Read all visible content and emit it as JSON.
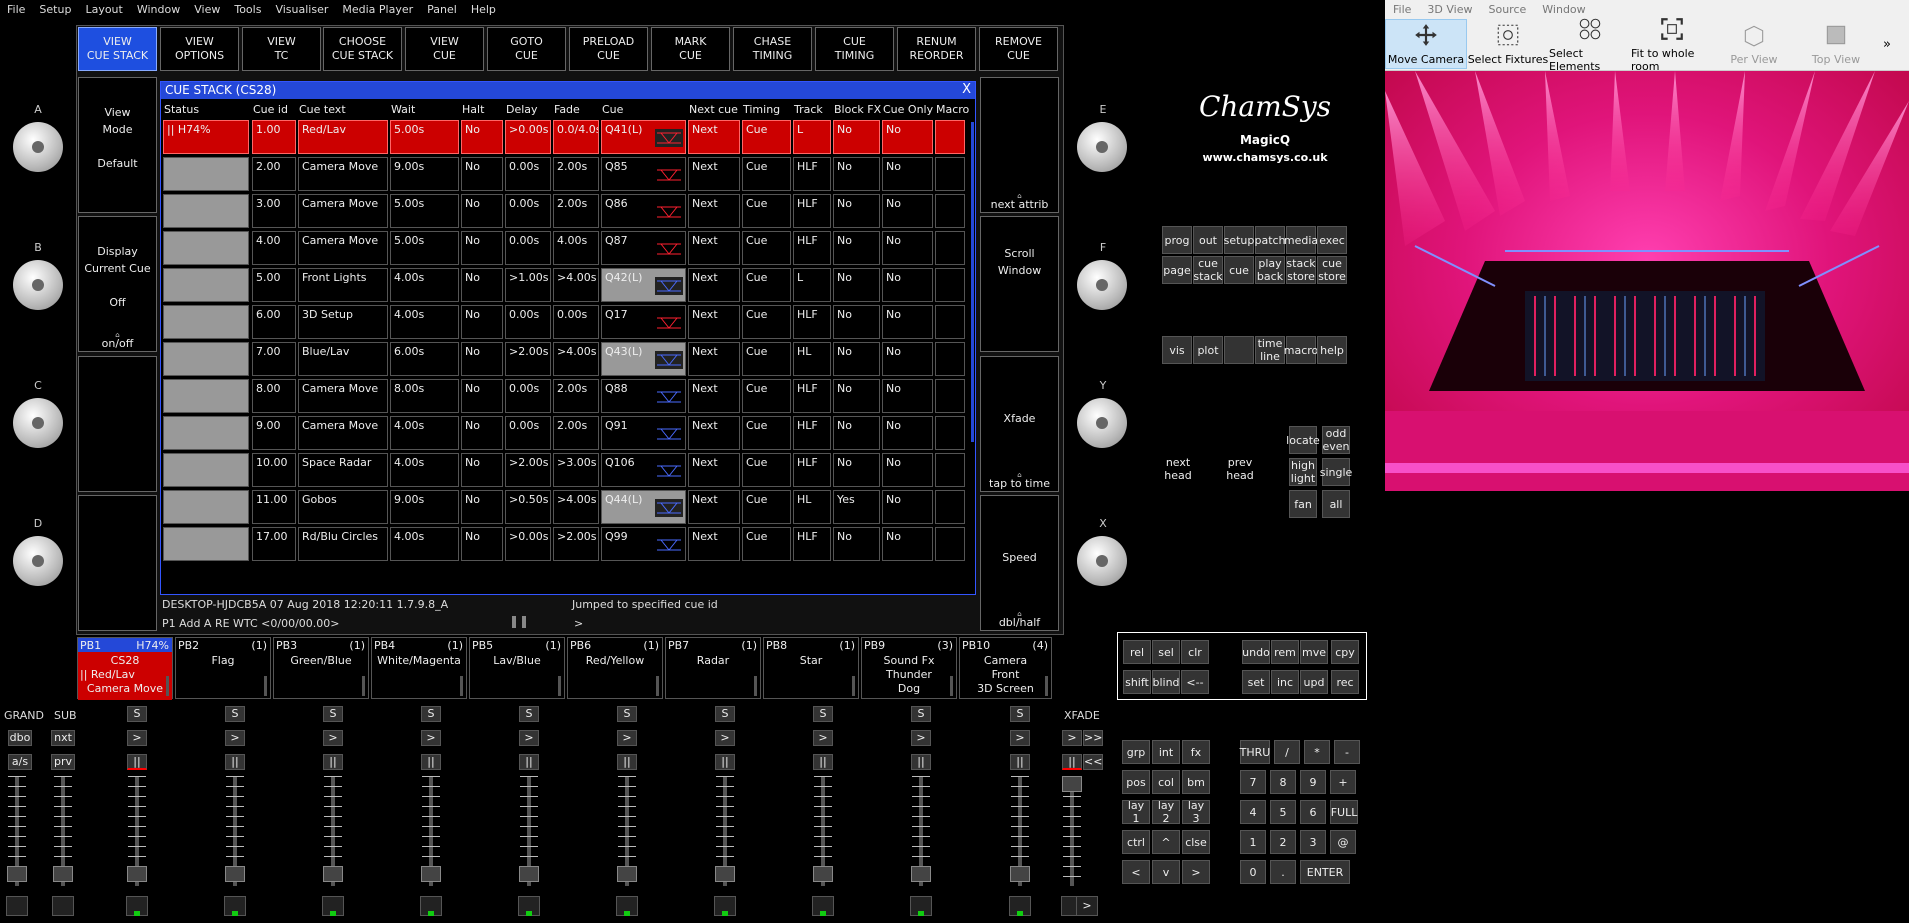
{
  "menubar": [
    "File",
    "Setup",
    "Layout",
    "Window",
    "View",
    "Tools",
    "Visualiser",
    "Media Player",
    "Panel",
    "Help"
  ],
  "win3d_menu": [
    "File",
    "3D View",
    "Source",
    "Window"
  ],
  "toolbar3d": [
    {
      "label": "Move Camera",
      "icon": "move-camera-icon",
      "selected": true
    },
    {
      "label": "Select Fixtures",
      "icon": "select-fixtures-icon"
    },
    {
      "label": "Select Elements",
      "icon": "select-elements-icon"
    },
    {
      "label": "Fit to whole room",
      "icon": "fit-room-icon"
    },
    {
      "label": "Per View",
      "icon": "per-view-icon",
      "disabled": true
    },
    {
      "label": "Top View",
      "icon": "top-view-icon",
      "disabled": true
    }
  ],
  "toolbar3d_more": "»",
  "top_buttons": [
    [
      "VIEW",
      "CUE STACK"
    ],
    [
      "VIEW",
      "OPTIONS"
    ],
    [
      "VIEW",
      "TC"
    ],
    [
      "CHOOSE",
      "CUE STACK"
    ],
    [
      "VIEW",
      "CUE"
    ],
    [
      "GOTO",
      "CUE"
    ],
    [
      "PRELOAD",
      "CUE"
    ],
    [
      "MARK",
      "CUE"
    ],
    [
      "CHASE",
      "TIMING"
    ],
    [
      "CUE",
      "TIMING"
    ],
    [
      "RENUM",
      "REORDER"
    ],
    [
      "REMOVE",
      "CUE"
    ]
  ],
  "left_buttons": [
    {
      "lines": [
        "View",
        "Mode",
        "",
        "Default"
      ]
    },
    {
      "lines": [
        "Display",
        "Current Cue",
        "",
        "Off"
      ],
      "bottom": "on/off"
    },
    {
      "lines": []
    },
    {
      "lines": []
    }
  ],
  "right_buttons": [
    {
      "lines": [],
      "bottom": "next attrib"
    },
    {
      "lines": [
        "Scroll",
        "Window"
      ]
    },
    {
      "lines": [
        "Xfade"
      ],
      "bottom": "tap to time"
    },
    {
      "lines": [
        "Speed"
      ],
      "bottom": "dbl/half"
    }
  ],
  "left_knobs": [
    "A",
    "B",
    "C",
    "D"
  ],
  "right_knobs": [
    "E",
    "F",
    "Y",
    "X"
  ],
  "cuestack": {
    "title": "CUE STACK (CS28)",
    "close": "X",
    "headers": [
      "Status",
      "Cue id",
      "Cue text",
      "Wait",
      "Halt",
      "Delay",
      "Fade",
      "Cue",
      "Next cue",
      "Timing",
      "Track",
      "Block FX",
      "Cue Only",
      "Macro"
    ],
    "rows": [
      [
        "|| H74%",
        "1.00",
        "Red/Lav",
        "5.00s",
        "No",
        ">0.00s",
        "0.0/4.0s",
        "Q41(L)",
        "Next",
        "Cue",
        "L",
        "No",
        "No",
        ""
      ],
      [
        "",
        "2.00",
        "Camera Move",
        "9.00s",
        "No",
        "0.00s",
        "2.00s",
        "Q85",
        "Next",
        "Cue",
        "HLF",
        "No",
        "No",
        ""
      ],
      [
        "",
        "3.00",
        "Camera Move",
        "5.00s",
        "No",
        "0.00s",
        "2.00s",
        "Q86",
        "Next",
        "Cue",
        "HLF",
        "No",
        "No",
        ""
      ],
      [
        "",
        "4.00",
        "Camera Move",
        "5.00s",
        "No",
        "0.00s",
        "4.00s",
        "Q87",
        "Next",
        "Cue",
        "HLF",
        "No",
        "No",
        ""
      ],
      [
        "",
        "5.00",
        "Front Lights",
        "4.00s",
        "No",
        ">1.00s",
        ">4.00s",
        "Q42(L)",
        "Next",
        "Cue",
        "L",
        "No",
        "No",
        ""
      ],
      [
        "",
        "6.00",
        "3D Setup",
        "4.00s",
        "No",
        "0.00s",
        "0.00s",
        "Q17",
        "Next",
        "Cue",
        "HLF",
        "No",
        "No",
        ""
      ],
      [
        "",
        "7.00",
        "Blue/Lav",
        "6.00s",
        "No",
        ">2.00s",
        ">4.00s",
        "Q43(L)",
        "Next",
        "Cue",
        "HL",
        "No",
        "No",
        ""
      ],
      [
        "",
        "8.00",
        "Camera Move",
        "8.00s",
        "No",
        "0.00s",
        "2.00s",
        "Q88",
        "Next",
        "Cue",
        "HLF",
        "No",
        "No",
        ""
      ],
      [
        "",
        "9.00",
        "Camera Move",
        "4.00s",
        "No",
        "0.00s",
        "2.00s",
        "Q91",
        "Next",
        "Cue",
        "HLF",
        "No",
        "No",
        ""
      ],
      [
        "",
        "10.00",
        "Space Radar",
        "4.00s",
        "No",
        ">2.00s",
        ">3.00s",
        "Q106",
        "Next",
        "Cue",
        "HLF",
        "No",
        "No",
        ""
      ],
      [
        "",
        "11.00",
        "Gobos",
        "9.00s",
        "No",
        ">0.50s",
        ">4.00s",
        "Q44(L)",
        "Next",
        "Cue",
        "HL",
        "Yes",
        "No",
        ""
      ],
      [
        "",
        "17.00",
        "Rd/Blu Circles",
        "4.00s",
        "No",
        ">0.00s",
        ">2.00s",
        "Q99",
        "Next",
        "Cue",
        "HLF",
        "No",
        "No",
        ""
      ]
    ]
  },
  "statusbar": {
    "host": "DESKTOP-HJDCB5A 07 Aug 2018 12:20:11 1.7.9.8_A",
    "message": "Jumped to specified cue id",
    "command": "P1  Add A  RE WTC <0/00/00.00>",
    "prompt": ">"
  },
  "playbacks": [
    {
      "num": "PB1",
      "count": "H74%",
      "lines": [
        "CS28",
        "|| Red/Lav",
        "Camera Move"
      ],
      "active": true
    },
    {
      "num": "PB2",
      "count": "(1)",
      "lines": [
        "Flag"
      ]
    },
    {
      "num": "PB3",
      "count": "(1)",
      "lines": [
        "Green/Blue"
      ]
    },
    {
      "num": "PB4",
      "count": "(1)",
      "lines": [
        "White/Magenta"
      ]
    },
    {
      "num": "PB5",
      "count": "(1)",
      "lines": [
        "Lav/Blue"
      ]
    },
    {
      "num": "PB6",
      "count": "(1)",
      "lines": [
        "Red/Yellow"
      ]
    },
    {
      "num": "PB7",
      "count": "(1)",
      "lines": [
        "Radar"
      ]
    },
    {
      "num": "PB8",
      "count": "(1)",
      "lines": [
        "Star"
      ]
    },
    {
      "num": "PB9",
      "count": "(3)",
      "lines": [
        "Sound Fx",
        "Thunder",
        "Dog"
      ]
    },
    {
      "num": "PB10",
      "count": "(4)",
      "lines": [
        "Camera",
        "Front",
        "3D Screen"
      ]
    }
  ],
  "grand_labels": [
    "GRAND",
    "SUB",
    "XFADE"
  ],
  "grand_buttons": [
    "dbo",
    "nxt",
    "a/s",
    "prv"
  ],
  "xfade_buttons": [
    ">",
    ">>",
    "||",
    "<<"
  ],
  "fader_buttons": [
    "S",
    ">",
    "||"
  ],
  "logo": {
    "brand": "ChamSys",
    "product": "MagicQ",
    "url": "www.chamsys.co.uk"
  },
  "grid_buttons": [
    [
      "prog",
      "out",
      "setup",
      "patch",
      "media",
      "exec"
    ],
    [
      "page",
      "cue stack",
      "cue",
      "play back",
      "stack store",
      "cue store"
    ],
    [
      "vis",
      "plot",
      "",
      "time line",
      "macro",
      "help"
    ]
  ],
  "head_buttons": [
    "next head",
    "prev head"
  ],
  "select_buttons": [
    "locate",
    "odd even",
    "high light",
    "single",
    "fan",
    "all"
  ],
  "prog_buttons": [
    [
      "rel",
      "sel",
      "clr",
      "",
      "undo",
      "rem",
      "mve",
      "cpy"
    ],
    [
      "shift",
      "blind",
      "<--",
      "",
      "set",
      "inc",
      "upd",
      "rec"
    ]
  ],
  "keypad_left": [
    [
      "grp",
      "int",
      "fx"
    ],
    [
      "pos",
      "col",
      "bm"
    ],
    [
      "lay 1",
      "lay 2",
      "lay 3"
    ],
    [
      "ctrl",
      "^",
      "clse"
    ],
    [
      "<",
      "v",
      ">"
    ]
  ],
  "keypad_num": [
    [
      "THRU",
      "/",
      "*",
      "-"
    ],
    [
      "7",
      "8",
      "9",
      "+"
    ],
    [
      "4",
      "5",
      "6",
      "FULL"
    ],
    [
      "1",
      "2",
      "3",
      "@"
    ],
    [
      "0",
      ".",
      "ENTER"
    ]
  ],
  "colors": {
    "active_blue": "#1e4fe0",
    "active_red": "#cc0000",
    "led_green": "#11cc11"
  }
}
